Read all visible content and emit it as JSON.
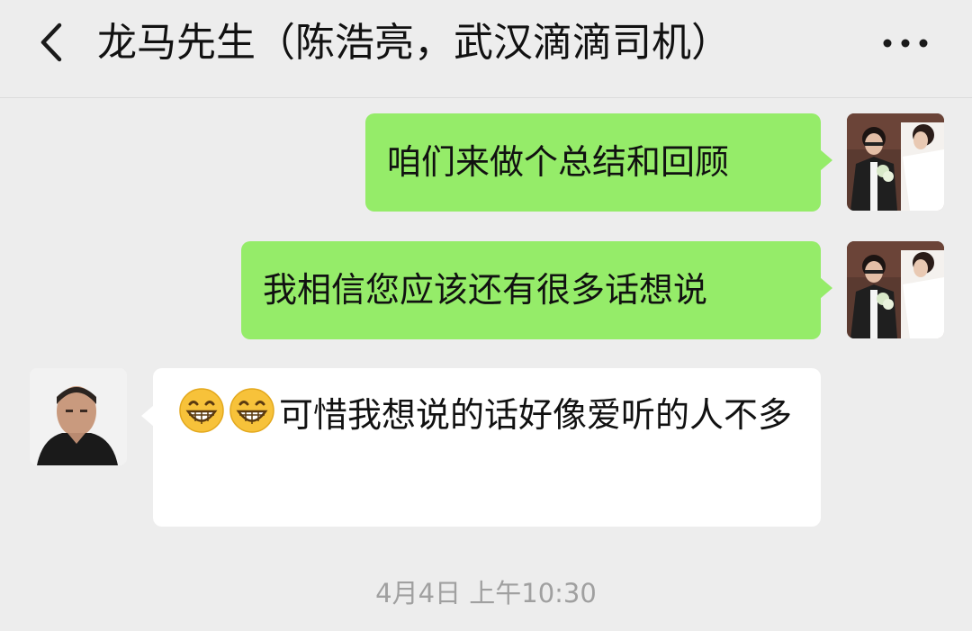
{
  "header": {
    "title": "龙马先生（陈浩亮，武汉滴滴司机）",
    "back_icon": "chevron-left-icon",
    "more_icon": "more-dots-icon"
  },
  "messages": [
    {
      "side": "sent",
      "text": "咱们来做个总结和回顾"
    },
    {
      "side": "sent",
      "text": "我相信您应该还有很多话想说"
    },
    {
      "side": "received",
      "emoji": [
        "grinning-face-icon",
        "grinning-face-icon"
      ],
      "text": "可惜我想说的话好像爱听的人不多"
    }
  ],
  "timestamp": "4月4日 上午10:30",
  "colors": {
    "background": "#ededed",
    "sent_bubble": "#95ec69",
    "received_bubble": "#ffffff",
    "timestamp_text": "#a0a0a0"
  }
}
